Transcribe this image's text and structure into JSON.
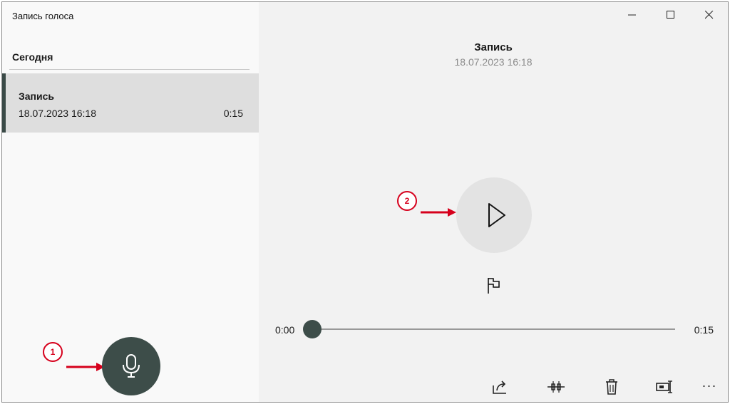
{
  "app": {
    "title": "Запись голоса"
  },
  "sidebar": {
    "section_header": "Сегодня",
    "recordings": [
      {
        "name": "Запись",
        "date": "18.07.2023 16:18",
        "duration": "0:15",
        "selected": true
      }
    ],
    "record_button_icon": "microphone-icon"
  },
  "window_controls": [
    "minimize-icon",
    "maximize-icon",
    "close-icon"
  ],
  "player": {
    "title": "Запись",
    "date": "18.07.2023 16:18",
    "time_current": "0:00",
    "time_total": "0:15",
    "progress": 0,
    "play_icon": "play-icon",
    "marker_icon": "flag-icon"
  },
  "toolbar": [
    "share-icon",
    "trim-icon",
    "delete-icon",
    "rename-icon",
    "more-icon"
  ],
  "annotations": [
    {
      "label": "1",
      "target": "record-button"
    },
    {
      "label": "2",
      "target": "play-button"
    }
  ],
  "colors": {
    "accent": "#3d4d49",
    "annotation_red": "#d6001c",
    "selected_item_bg": "#dedede",
    "play_circle_bg": "#e3e3e3"
  }
}
